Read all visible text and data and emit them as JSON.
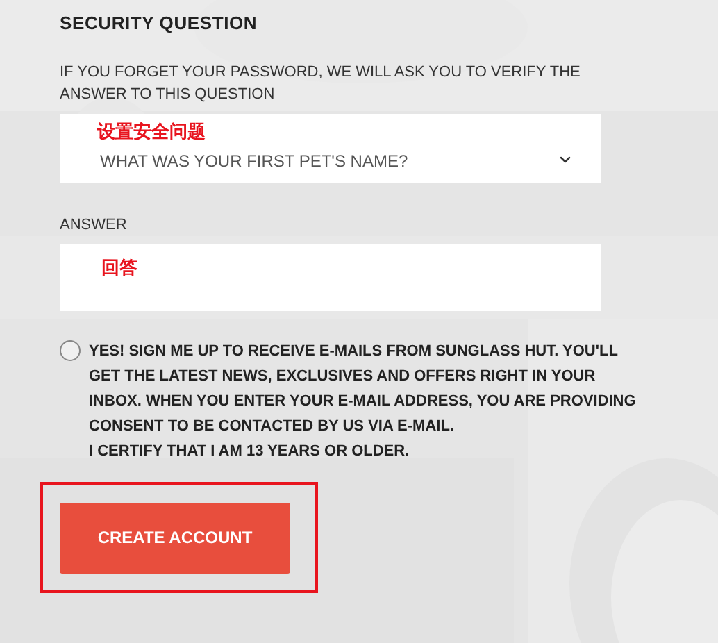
{
  "security_question": {
    "heading": "SECURITY QUESTION",
    "hint": "IF YOU FORGET YOUR PASSWORD, WE WILL ASK YOU TO VERIFY THE ANSWER TO THIS QUESTION",
    "select": {
      "value": "WHAT WAS YOUR FIRST PET'S NAME?",
      "annotation": "设置安全问题"
    }
  },
  "answer": {
    "label": "ANSWER",
    "annotation": "回答"
  },
  "newsletter": {
    "checked": false,
    "text": "YES! SIGN ME UP TO RECEIVE E-MAILS FROM SUNGLASS HUT. YOU'LL GET THE LATEST NEWS, EXCLUSIVES AND OFFERS RIGHT IN YOUR INBOX. WHEN YOU ENTER YOUR E-MAIL ADDRESS, YOU ARE PROVIDING CONSENT TO BE CONTACTED BY US VIA E-MAIL.",
    "certify": "I CERTIFY THAT I AM 13 YEARS OR OLDER."
  },
  "create_account_button": {
    "label": "CREATE ACCOUNT",
    "highlighted": true
  }
}
